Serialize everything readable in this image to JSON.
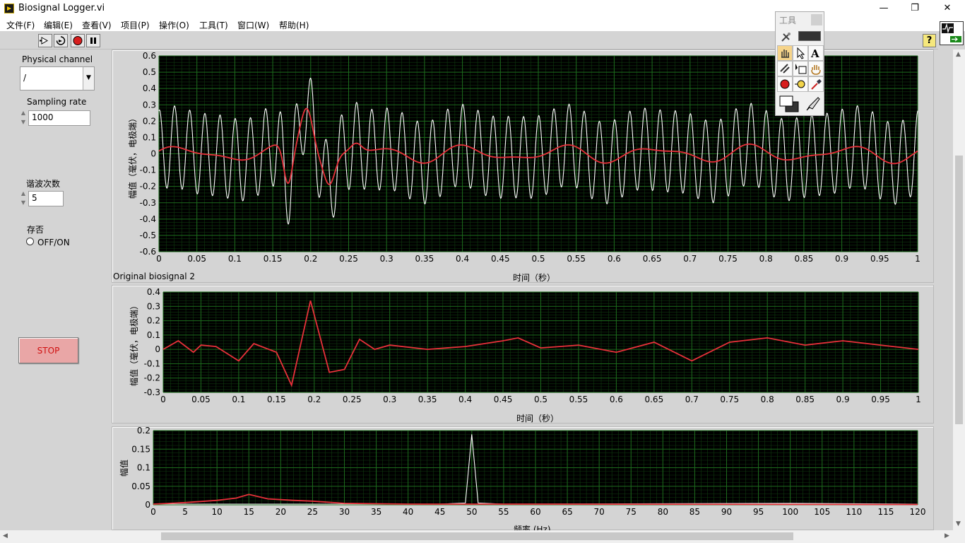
{
  "window": {
    "title": "Biosignal Logger.vi",
    "min": "—",
    "max": "❐",
    "close": "✕"
  },
  "menu": [
    "文件(F)",
    "编辑(E)",
    "查看(V)",
    "项目(P)",
    "操作(O)",
    "工具(T)",
    "窗口(W)",
    "帮助(H)"
  ],
  "toolbar": {
    "help": "?"
  },
  "controls": {
    "physical_channel": {
      "label": "Physical channel",
      "value": "/"
    },
    "sampling_rate": {
      "label": "Sampling rate",
      "value": "1000"
    },
    "harmonics": {
      "label": "谐波次数",
      "value": "5"
    },
    "save": {
      "label": "存否",
      "option": "OFF/ON"
    },
    "stop": {
      "label": "STOP"
    }
  },
  "tools_palette": {
    "title": "工具"
  },
  "colors": {
    "plot_bg": "#000000",
    "grid": "#1d6b1d",
    "trace_white": "#ffffff",
    "trace_red": "#e8303a",
    "panel": "#d4d4d4"
  },
  "chart_data": [
    {
      "type": "line",
      "title": "",
      "xlabel": "时间（秒）",
      "ylabel": "幅值（毫伏，电极端）",
      "xlim": [
        0,
        1
      ],
      "ylim": [
        -0.6,
        0.6
      ],
      "x_ticks": [
        "0",
        "0.05",
        "0.1",
        "0.15",
        "0.2",
        "0.25",
        "0.3",
        "0.35",
        "0.4",
        "0.45",
        "0.5",
        "0.55",
        "0.6",
        "0.65",
        "0.7",
        "0.75",
        "0.8",
        "0.85",
        "0.9",
        "0.95",
        "1"
      ],
      "y_ticks": [
        "0.6",
        "0.5",
        "0.4",
        "0.3",
        "0.2",
        "0.1",
        "0",
        "-0.1",
        "-0.2",
        "-0.3",
        "-0.4",
        "-0.5",
        "-0.6"
      ],
      "series": [
        {
          "color": "white",
          "description_values": {
            "peak": 0.54,
            "trough": -0.5,
            "sine_freq_hz": 50,
            "sine_amplitude": 0.25
          }
        },
        {
          "color": "red",
          "description_values": {
            "peak": 0.31,
            "trough": -0.23
          }
        }
      ]
    },
    {
      "type": "line",
      "title": "Original biosignal 2",
      "xlabel": "时间（秒）",
      "ylabel": "幅值（毫伏，电极端）",
      "xlim": [
        0,
        1
      ],
      "ylim": [
        -0.3,
        0.4
      ],
      "x_ticks": [
        "0",
        "0.05",
        "0.1",
        "0.15",
        "0.2",
        "0.25",
        "0.3",
        "0.35",
        "0.4",
        "0.45",
        "0.5",
        "0.55",
        "0.6",
        "0.65",
        "0.7",
        "0.75",
        "0.8",
        "0.85",
        "0.9",
        "0.95",
        "1"
      ],
      "y_ticks": [
        "0.4",
        "0.3",
        "0.2",
        "0.1",
        "0",
        "-0.1",
        "-0.2",
        "-0.3"
      ],
      "series": [
        {
          "color": "red",
          "points": [
            [
              0,
              0
            ],
            [
              0.02,
              0.06
            ],
            [
              0.03,
              0.02
            ],
            [
              0.04,
              -0.02
            ],
            [
              0.05,
              0.03
            ],
            [
              0.07,
              0.02
            ],
            [
              0.1,
              -0.08
            ],
            [
              0.12,
              0.04
            ],
            [
              0.15,
              -0.02
            ],
            [
              0.17,
              -0.25
            ],
            [
              0.195,
              0.34
            ],
            [
              0.22,
              -0.16
            ],
            [
              0.24,
              -0.14
            ],
            [
              0.26,
              0.07
            ],
            [
              0.28,
              0.0
            ],
            [
              0.3,
              0.03
            ],
            [
              0.35,
              0.0
            ],
            [
              0.4,
              0.02
            ],
            [
              0.45,
              0.06
            ],
            [
              0.47,
              0.08
            ],
            [
              0.5,
              0.01
            ],
            [
              0.55,
              0.03
            ],
            [
              0.6,
              -0.02
            ],
            [
              0.65,
              0.05
            ],
            [
              0.7,
              -0.08
            ],
            [
              0.75,
              0.05
            ],
            [
              0.8,
              0.08
            ],
            [
              0.85,
              0.03
            ],
            [
              0.9,
              0.06
            ],
            [
              0.95,
              0.03
            ],
            [
              1,
              0
            ]
          ]
        }
      ]
    },
    {
      "type": "line",
      "title": "",
      "xlabel": "频率 (Hz)",
      "ylabel": "幅值",
      "xlim": [
        0,
        120
      ],
      "ylim": [
        0,
        0.2
      ],
      "x_ticks": [
        "0",
        "5",
        "10",
        "15",
        "20",
        "25",
        "30",
        "35",
        "40",
        "45",
        "50",
        "55",
        "60",
        "65",
        "70",
        "75",
        "80",
        "85",
        "90",
        "95",
        "100",
        "105",
        "110",
        "115",
        "120"
      ],
      "y_ticks": [
        "0.2",
        "0.15",
        "0.1",
        "0.05",
        "0"
      ],
      "series": [
        {
          "color": "white",
          "points": [
            [
              0,
              0.002
            ],
            [
              45,
              0.002
            ],
            [
              49,
              0.005
            ],
            [
              50,
              0.19
            ],
            [
              51,
              0.005
            ],
            [
              55,
              0.002
            ],
            [
              100,
              0.004
            ],
            [
              120,
              0.002
            ]
          ]
        },
        {
          "color": "red",
          "points": [
            [
              0,
              0.002
            ],
            [
              5,
              0.006
            ],
            [
              10,
              0.012
            ],
            [
              13,
              0.018
            ],
            [
              15,
              0.028
            ],
            [
              18,
              0.016
            ],
            [
              22,
              0.012
            ],
            [
              25,
              0.01
            ],
            [
              30,
              0.004
            ],
            [
              40,
              0.002
            ],
            [
              60,
              0.002
            ],
            [
              120,
              0.001
            ]
          ]
        }
      ]
    }
  ]
}
